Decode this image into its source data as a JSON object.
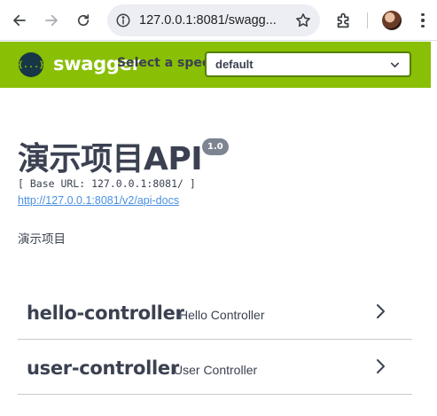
{
  "browser": {
    "url": "127.0.0.1:8081/swagg...",
    "icons": {
      "back": "arrow-left-icon",
      "forward": "arrow-right-icon",
      "reload": "reload-icon",
      "info": "info-icon",
      "bookmark": "star-icon",
      "extensions": "puzzle-icon",
      "menu": "kebab-menu-icon"
    }
  },
  "swagger_bar": {
    "logo_glyph": "{...}",
    "brand": "swagger",
    "select_label": "Select a spec",
    "selected_spec": "default",
    "colors": {
      "bar": "#89bf04",
      "logo_bg": "#173647"
    }
  },
  "info": {
    "title": "演示项目API",
    "version": "1.0",
    "base_url": "[ Base URL: 127.0.0.1:8081/ ]",
    "docs_link": "http://127.0.0.1:8081/v2/api-docs",
    "description": "演示项目"
  },
  "controllers": [
    {
      "name": "hello-controller",
      "description": "Hello Controller"
    },
    {
      "name": "user-controller",
      "description": "User Controller"
    }
  ]
}
